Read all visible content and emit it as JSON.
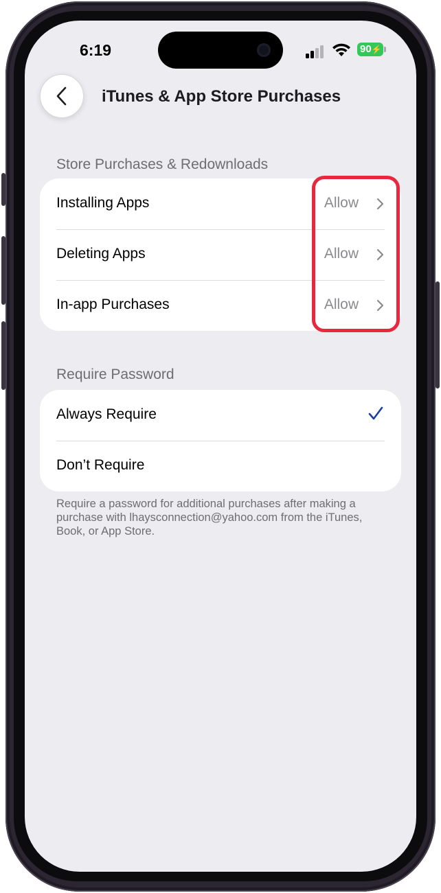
{
  "status_bar": {
    "time": "6:19",
    "battery": "90"
  },
  "nav": {
    "title": "iTunes & App Store Purchases"
  },
  "section_store": {
    "header": "Store Purchases & Redownloads",
    "rows": [
      {
        "label": "Installing Apps",
        "value": "Allow"
      },
      {
        "label": "Deleting Apps",
        "value": "Allow"
      },
      {
        "label": "In-app Purchases",
        "value": "Allow"
      }
    ]
  },
  "section_password": {
    "header": "Require Password",
    "rows": [
      {
        "label": "Always Require",
        "selected": true
      },
      {
        "label": "Don’t Require",
        "selected": false
      }
    ],
    "footer": "Require a password for additional purchases after making a purchase with lhaysconnection@yahoo.com from the iTunes, Book, or App Store."
  },
  "colors": {
    "accent": "#1a3fa0",
    "highlight": "#e8283e",
    "battery": "#34c759"
  }
}
